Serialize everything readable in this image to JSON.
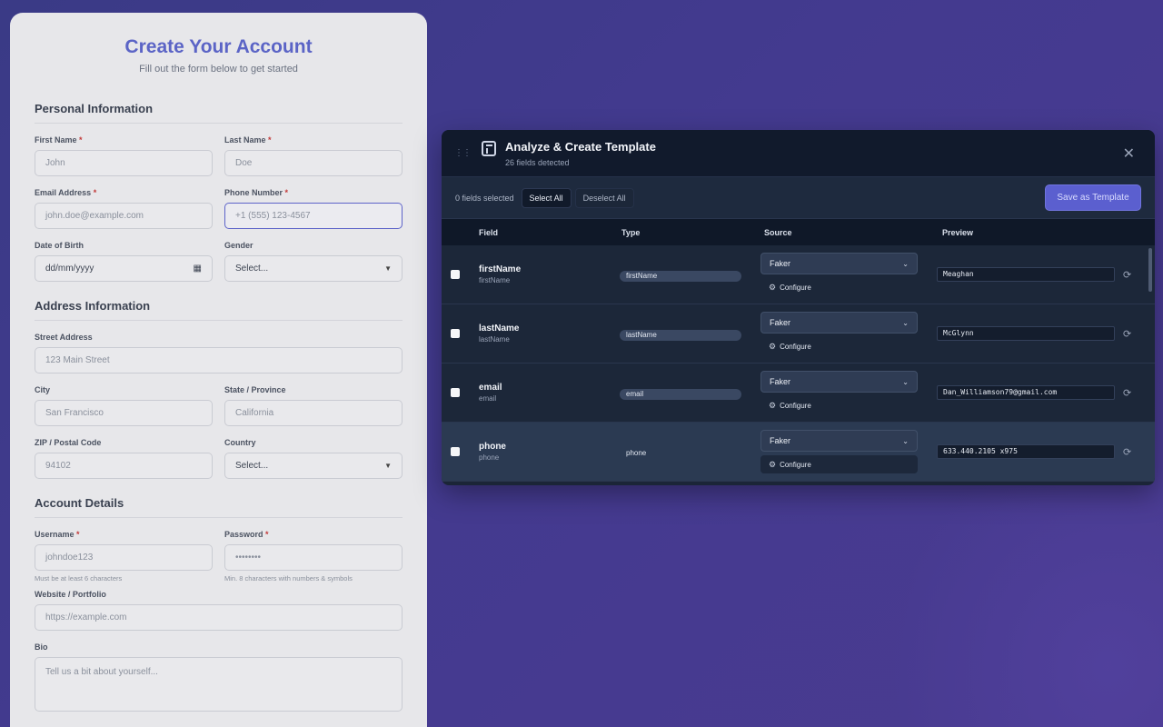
{
  "form": {
    "title": "Create Your Account",
    "subtitle": "Fill out the form below to get started",
    "sections": {
      "personal": "Personal Information",
      "address": "Address Information",
      "account": "Account Details"
    },
    "required_mark": "*",
    "fields": {
      "first_name": {
        "label": "First Name",
        "placeholder": "John"
      },
      "last_name": {
        "label": "Last Name",
        "placeholder": "Doe"
      },
      "email": {
        "label": "Email Address",
        "placeholder": "john.doe@example.com"
      },
      "phone": {
        "label": "Phone Number",
        "placeholder": "+1 (555) 123-4567"
      },
      "dob": {
        "label": "Date of Birth",
        "placeholder": "dd/mm/yyyy"
      },
      "gender": {
        "label": "Gender",
        "value": "Select..."
      },
      "street": {
        "label": "Street Address",
        "placeholder": "123 Main Street"
      },
      "city": {
        "label": "City",
        "placeholder": "San Francisco"
      },
      "state": {
        "label": "State / Province",
        "placeholder": "California"
      },
      "zip": {
        "label": "ZIP / Postal Code",
        "placeholder": "94102"
      },
      "country": {
        "label": "Country",
        "value": "Select..."
      },
      "username": {
        "label": "Username",
        "placeholder": "johndoe123",
        "hint": "Must be at least 6 characters"
      },
      "password": {
        "label": "Password",
        "placeholder": "••••••••",
        "hint": "Min. 8 characters with numbers & symbols"
      },
      "website": {
        "label": "Website / Portfolio",
        "placeholder": "https://example.com"
      },
      "bio": {
        "label": "Bio",
        "placeholder": "Tell us a bit about yourself..."
      }
    }
  },
  "panel": {
    "title": "Analyze & Create Template",
    "subtitle": "26 fields detected",
    "toolbar": {
      "selected_count": "0 fields selected",
      "select_all": "Select All",
      "deselect_all": "Deselect All",
      "save_template": "Save as Template"
    },
    "columns": {
      "field": "Field",
      "type": "Type",
      "source": "Source",
      "preview": "Preview"
    },
    "configure_label": "Configure",
    "rows": [
      {
        "name": "firstName",
        "sub": "firstName",
        "type": "firstName",
        "source": "Faker",
        "preview": "Meaghan"
      },
      {
        "name": "lastName",
        "sub": "lastName",
        "type": "lastName",
        "source": "Faker",
        "preview": "McGlynn"
      },
      {
        "name": "email",
        "sub": "email",
        "type": "email",
        "source": "Faker",
        "preview": "Dan_Williamson79@gmail.com"
      },
      {
        "name": "phone",
        "sub": "phone",
        "type": "phone",
        "source": "Faker",
        "preview": "633.440.2105 x975"
      }
    ]
  },
  "icons": {
    "drag": "drag-handle-icon",
    "logo": "template-logo-icon",
    "close": "close-icon",
    "chevron": "chevron-down-icon",
    "configure": "gear-icon",
    "refresh": "refresh-icon",
    "calendar": "calendar-icon"
  },
  "colors": {
    "accent": "#5b64c6",
    "save_button": "#5b5fcf",
    "panel_bg": "#1b2537"
  }
}
